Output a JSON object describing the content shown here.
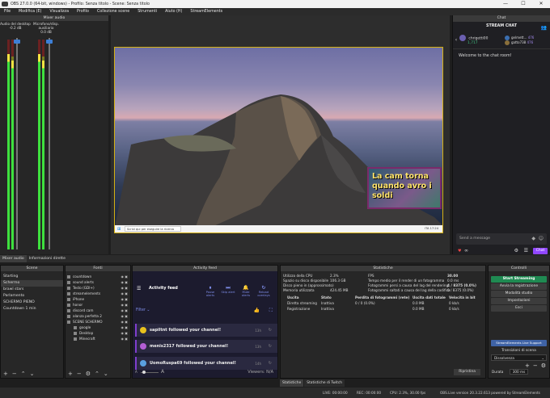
{
  "window": {
    "title": "OBS 27.0.0 (64-bit, windows) - Profilo: Senza titolo - Scene: Senza titolo",
    "min": "—",
    "max": "☐",
    "close": "✕"
  },
  "menu": [
    "File",
    "Modifica (E)",
    "Visualizza",
    "Profilo",
    "Collezione scene",
    "Strumenti",
    "Aiuto (H)",
    "StreamElements"
  ],
  "mixer": {
    "title": "Mixer audio",
    "channels": [
      {
        "name": "Audio del desktop",
        "db": "-0.2 dB",
        "level": 0.93
      },
      {
        "name": "Microfono/disp. ausiliario",
        "db": "0.0 dB",
        "level": 0.93
      }
    ]
  },
  "preview": {
    "taskbar_search": "Scrivi qui per eseguire la ricerca",
    "taskbar_tray": "ITA  17:24",
    "overlay_text": "La cam torna quando avro i soldi"
  },
  "chat": {
    "title": "Chat",
    "header": "STREAM CHAT",
    "leaders": [
      {
        "name": "chrigetti00",
        "points": "1,717"
      },
      {
        "name": "gelmett...",
        "points": "476"
      },
      {
        "name": "gatto738",
        "points": "476"
      }
    ],
    "welcome": "Welcome to the chat room!",
    "send_placeholder": "Send a message",
    "chat_button": "Chat",
    "points_label": "∞"
  },
  "tabs": {
    "mixer": "Mixer audio",
    "info": "Informazioni dirette"
  },
  "scenes": {
    "title": "Scene",
    "items": [
      "Starting",
      "Schermo",
      "brawl stars",
      "Parlamento",
      "SCHERMO PIENO",
      "Countdown 1 min"
    ],
    "selected_index": 1
  },
  "sources": {
    "title": "Fonti",
    "items": [
      {
        "name": "countdown",
        "indent": false
      },
      {
        "name": "sound alerts",
        "indent": false
      },
      {
        "name": "Testo (GDI+)",
        "indent": false
      },
      {
        "name": "streamelements",
        "indent": false
      },
      {
        "name": "iPhone",
        "indent": false
      },
      {
        "name": "honor",
        "indent": false
      },
      {
        "name": "discord cam",
        "indent": false
      },
      {
        "name": "alanza perfetta 2",
        "indent": false
      },
      {
        "name": "SCENE SCHERMO",
        "indent": false
      },
      {
        "name": "google",
        "indent": true
      },
      {
        "name": "Desktop",
        "indent": true
      },
      {
        "name": "Minecraft",
        "indent": true
      }
    ]
  },
  "activity": {
    "title": "Activity feed",
    "header": "Activity feed",
    "buttons": [
      "Pause alerts",
      "Skip alert",
      "Mute alerts",
      "Reload overlays"
    ],
    "filter": "Filter",
    "items": [
      {
        "text": "sapiltnt followed your channel!",
        "time": "13h",
        "color": "#e8c11d"
      },
      {
        "text": "menis2317 followed your channel!",
        "time": "13h",
        "color": "#b45ed6"
      },
      {
        "text": "UomoRuspa69 followed your channel!",
        "time": "14h",
        "color": "#5aa0e0"
      }
    ],
    "font_small": "A",
    "font_large": "A",
    "viewers": "Viewers: N/A"
  },
  "stats": {
    "title": "Statistiche",
    "left": [
      {
        "label": "Utilizzo della CPU",
        "value": "2.3%"
      },
      {
        "label": "Spazio su disco disponibile",
        "value": "106.3 GB"
      },
      {
        "label": "Disco pieno in (approssimato)",
        "value": ""
      },
      {
        "label": "Memoria utilizzata",
        "value": "424.45 MB"
      }
    ],
    "right": [
      {
        "label": "FPS",
        "value": "30.00"
      },
      {
        "label": "Tempo medio per il render di un fotogramma",
        "value": "0.0 ms"
      },
      {
        "label": "Fotogrammi persi a causa del lag del rendering",
        "value": "4 / 8375 (0.0%)"
      },
      {
        "label": "Fotogrammi saltati a causa del lag della codifica",
        "value": "0 / 8375 (0.0%)"
      }
    ],
    "table_headers": [
      "Uscita",
      "Stato",
      "Perdita di fotogrammi (rete)",
      "Uscita dati totale",
      "Velocità in bit"
    ],
    "table_rows": [
      [
        "Diretta streaming",
        "Inattiva",
        "0 / 0 (0.0%)",
        "0.0 MB",
        "0 kb/s"
      ],
      [
        "Registrazione",
        "Inattiva",
        "",
        "0.0 MB",
        "0 kb/s"
      ]
    ],
    "reset": "Ripristina"
  },
  "bottom_tabs": [
    "Statistiche",
    "Statistiche di Twitch"
  ],
  "controls": {
    "title": "Controlli",
    "start_streaming": "Start Streaming",
    "start_recording": "Avvia la registrazione",
    "studio_mode": "Modalità studio",
    "settings": "Impostazioni",
    "exit": "Esci",
    "support": "StreamElements Live Support",
    "transitions_title": "Transizioni di scena",
    "transition": "Dissolvenza",
    "duration_label": "Durata",
    "duration": "300 ms"
  },
  "statusbar": {
    "live": "LIVE: 00:00:00",
    "rec": "REC: 00:00:00",
    "cpu": "CPU: 2.3%, 30.00 fps",
    "version": "OBS.Live version 20.3.22.613 powered by StreamElements"
  }
}
